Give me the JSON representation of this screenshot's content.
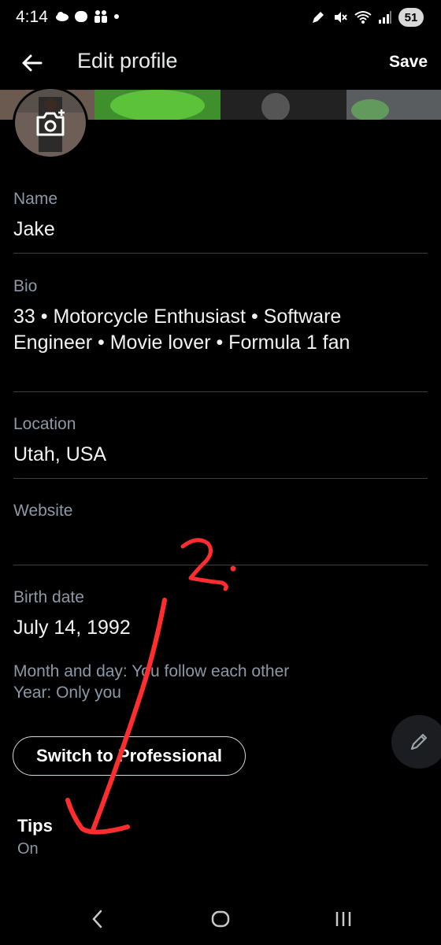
{
  "status_bar": {
    "time": "4:14",
    "battery": "51"
  },
  "header": {
    "title": "Edit profile",
    "save_label": "Save"
  },
  "fields": {
    "name": {
      "label": "Name",
      "value": "Jake"
    },
    "bio": {
      "label": "Bio",
      "value_line1": "33 • Motorcycle Enthusiast • Software",
      "value_line2": "Engineer • Movie lover • Formula 1 fan"
    },
    "location": {
      "label": "Location",
      "value": "Utah, USA"
    },
    "website": {
      "label": "Website",
      "value": ""
    },
    "birth_date": {
      "label": "Birth date",
      "value": "July 14, 1992"
    }
  },
  "birth_date_hints": {
    "line1": "Month and day: You follow each other",
    "line2": "Year: Only you"
  },
  "professional_button": "Switch to Professional",
  "tips": {
    "label": "Tips",
    "value": "On"
  },
  "icons": [
    "back-arrow-icon",
    "camera-plus-icon",
    "pencil-icon",
    "nav-back-icon",
    "nav-home-icon",
    "nav-recents-icon"
  ],
  "annotation_text": "2.",
  "colors": {
    "background": "#000000",
    "secondary_text": "#8b98a5",
    "annotation": "#ff2d2d"
  }
}
